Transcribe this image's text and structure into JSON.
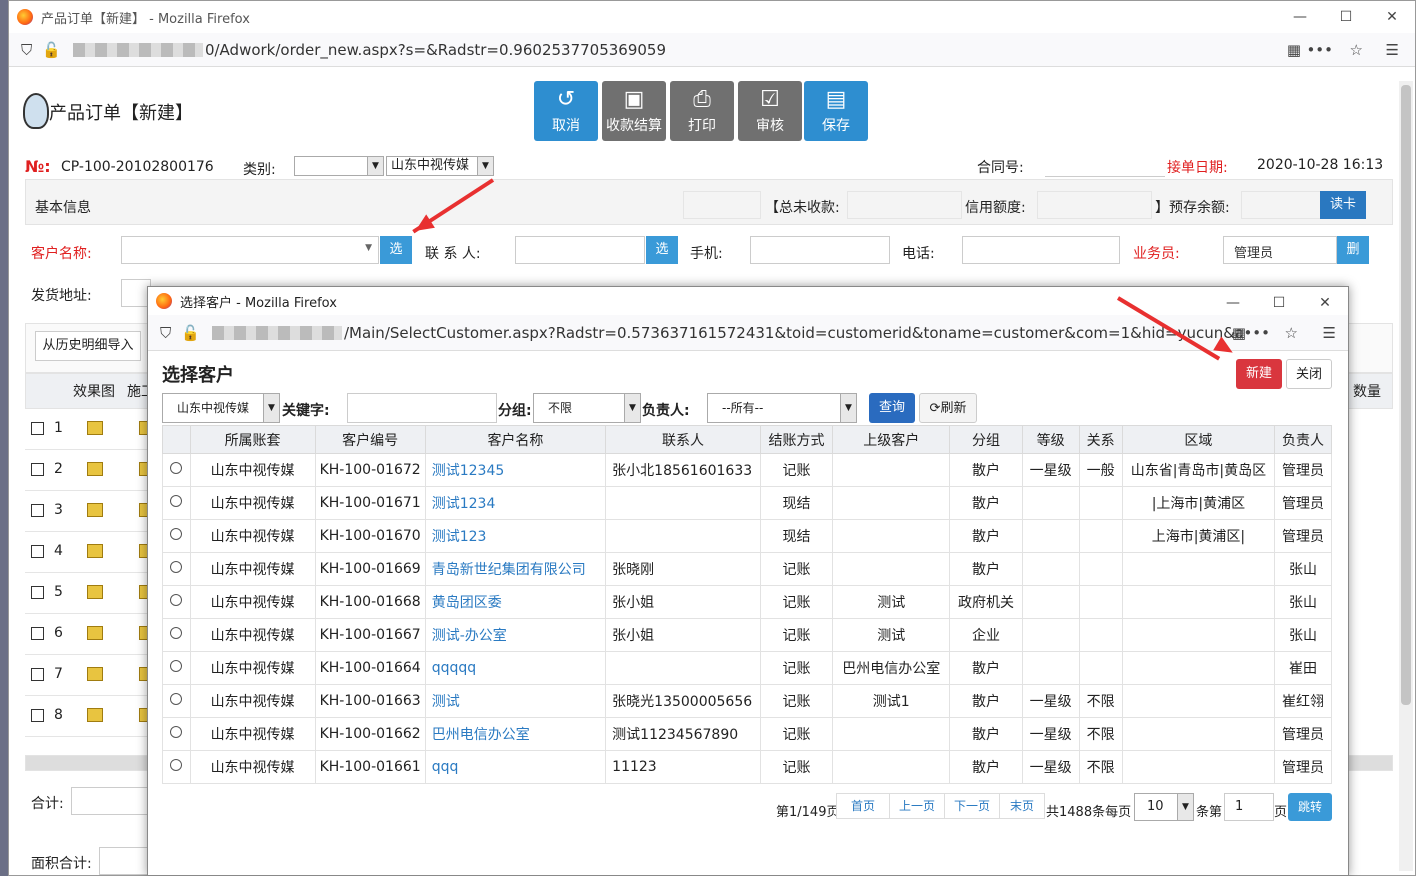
{
  "main_window": {
    "title": "产品订单【新建】 - Mozilla Firefox",
    "url_suffix": "0/Adwork/order_new.aspx?s=&Radstr=0.9602537705369059",
    "page_title": "产品订单【新建】",
    "toolbar": [
      {
        "label": "取消",
        "glyph": "↺",
        "color": "#2e8ed0"
      },
      {
        "label": "收款结算",
        "glyph": "💵",
        "color": "#707070"
      },
      {
        "label": "打印",
        "glyph": "🖶",
        "color": "#707070"
      },
      {
        "label": "审核",
        "glyph": "☑",
        "color": "#707070"
      },
      {
        "label": "保存",
        "glyph": "💾",
        "color": "#2e8ed0"
      }
    ],
    "order_no_label": "№:",
    "order_no": "CP-100-20102800176",
    "category_label": "类别:",
    "category_value": "",
    "company_value": "山东中视传媒",
    "contract_label": "合同号:",
    "order_date_label": "接单日期:",
    "order_date": "2020-10-28 16:13",
    "basic_info": "基本信息",
    "total_unpaid_label": "【总未收款:",
    "credit_label": "信用额度:",
    "prepay_label": "】预存余额:",
    "read_card": "读卡",
    "customer_label": "客户名称:",
    "select_btn": "选",
    "contact_label": "联 系 人:",
    "phone_label": "手机:",
    "tel_label": "电话:",
    "salesman_label": "业务员:",
    "salesman_value": "管理员",
    "delete_btn": "删",
    "address_label": "发货地址:",
    "history_import": "从历史明细导入",
    "grid_headers": [
      "效果图",
      "施工"
    ],
    "grid_rows": [
      "1",
      "2",
      "3",
      "4",
      "5",
      "6",
      "7",
      "8"
    ],
    "total_label": "合计:",
    "area_total_label": "面积合计:",
    "qty_header": "数量"
  },
  "popup": {
    "title": "选择客户 - Mozilla Firefox",
    "url_suffix": "/Main/SelectCustomer.aspx?Radstr=0.573637161572431&toid=customerid&toname=customer&com=1&hid=yucun&addr=addr&li",
    "heading": "选择客户",
    "new_btn": "新建",
    "close_btn": "关闭",
    "company_select": "山东中视传媒",
    "keyword_label": "关键字:",
    "group_label": "分组:",
    "group_value": "不限",
    "owner_label": "负责人:",
    "owner_value": "--所有--",
    "query_btn": "查询",
    "refresh_btn": "刷新",
    "headers": [
      "",
      "所属账套",
      "客户编号",
      "客户名称",
      "联系人",
      "结账方式",
      "上级客户",
      "分组",
      "等级",
      "关系",
      "区域",
      "负责人"
    ],
    "rows": [
      [
        "山东中视传媒",
        "KH-100-01672",
        "测试12345",
        "张小北18561601633",
        "记账",
        "",
        "散户",
        "一星级",
        "一般",
        "山东省|青岛市|黄岛区",
        "管理员"
      ],
      [
        "山东中视传媒",
        "KH-100-01671",
        "测试1234",
        "",
        "现结",
        "",
        "散户",
        "",
        "",
        "|上海市|黄浦区",
        "管理员"
      ],
      [
        "山东中视传媒",
        "KH-100-01670",
        "测试123",
        "",
        "现结",
        "",
        "散户",
        "",
        "",
        "上海市|黄浦区|",
        "管理员"
      ],
      [
        "山东中视传媒",
        "KH-100-01669",
        "青岛新世纪集团有限公司",
        "张晓刚",
        "记账",
        "",
        "散户",
        "",
        "",
        "",
        "张山"
      ],
      [
        "山东中视传媒",
        "KH-100-01668",
        "黄岛团区委",
        "张小姐",
        "记账",
        "测试",
        "政府机关",
        "",
        "",
        "",
        "张山"
      ],
      [
        "山东中视传媒",
        "KH-100-01667",
        "测试-办公室",
        "张小姐",
        "记账",
        "测试",
        "企业",
        "",
        "",
        "",
        "张山"
      ],
      [
        "山东中视传媒",
        "KH-100-01664",
        "qqqqq",
        "",
        "记账",
        "巴州电信办公室",
        "散户",
        "",
        "",
        "",
        "崔田"
      ],
      [
        "山东中视传媒",
        "KH-100-01663",
        "测试",
        "张晓光13500005656",
        "记账",
        "测试1",
        "散户",
        "一星级",
        "不限",
        "",
        "崔红翎"
      ],
      [
        "山东中视传媒",
        "KH-100-01662",
        "巴州电信办公室",
        "测试11234567890",
        "记账",
        "",
        "散户",
        "一星级",
        "不限",
        "",
        "管理员"
      ],
      [
        "山东中视传媒",
        "KH-100-01661",
        "qqq",
        "11123",
        "记账",
        "",
        "散户",
        "一星级",
        "不限",
        "",
        "管理员"
      ]
    ],
    "pager": {
      "page_info": "第1/149页",
      "first": "首页",
      "prev": "上一页",
      "next": "下一页",
      "last": "末页",
      "total": "共1488条每页",
      "page_size": "10",
      "per_label": "条第",
      "page_input": "1",
      "page_suffix": "页",
      "jump": "跳转"
    }
  },
  "colors": {
    "accent": "#2e8ed0",
    "danger": "#d9363e",
    "label_red": "#e02020",
    "arrow": "#e83030"
  }
}
